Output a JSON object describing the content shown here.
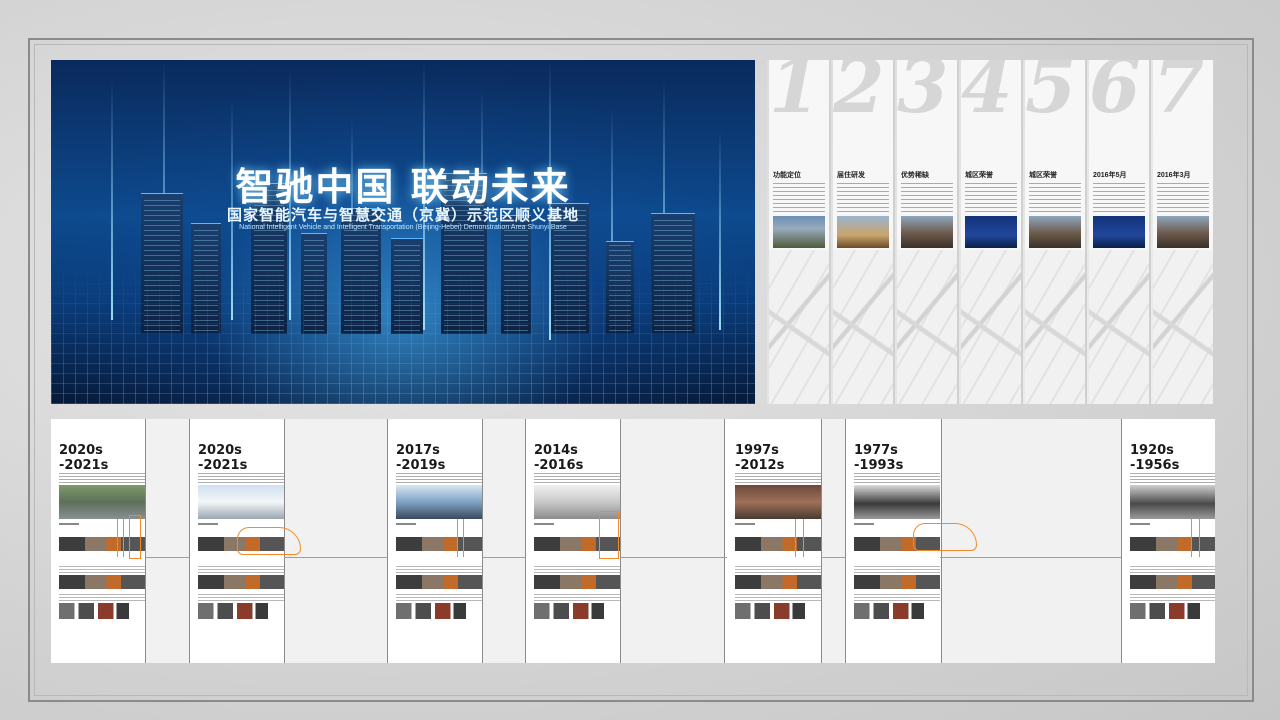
{
  "hero": {
    "title": "智驰中国 联动未来",
    "subtitle": "国家智能汽车与智慧交通（京冀）示范区顺义基地",
    "subtitle_en": "National Intelligent Vehicle and Intelligent Transportation (Beijing-Hebei) Demonstration Area Shunyi Base"
  },
  "panels": [
    {
      "number": "1",
      "title": "功能定位"
    },
    {
      "number": "2",
      "title": "届住研发"
    },
    {
      "number": "3",
      "title": "优势稀缺"
    },
    {
      "number": "4",
      "title": "城区荣誉"
    },
    {
      "number": "5",
      "title": "城区荣誉"
    },
    {
      "number": "6",
      "title": "2016年5月"
    },
    {
      "number": "7",
      "title": "2016年3月"
    }
  ],
  "timeline": [
    {
      "years_top": "2020s",
      "years_bottom": "-2021s"
    },
    {
      "years_top": "2020s",
      "years_bottom": "-2021s"
    },
    {
      "years_top": "2017s",
      "years_bottom": "-2019s"
    },
    {
      "years_top": "2014s",
      "years_bottom": "-2016s"
    },
    {
      "years_top": "1997s",
      "years_bottom": "-2012s"
    },
    {
      "years_top": "1977s",
      "years_bottom": "-1993s"
    },
    {
      "years_top": "1920s",
      "years_bottom": "-1956s"
    }
  ],
  "colors": {
    "accent": "#f28a2a",
    "hero_blue": "#0d4a8e",
    "frame": "#8a8a8a"
  }
}
